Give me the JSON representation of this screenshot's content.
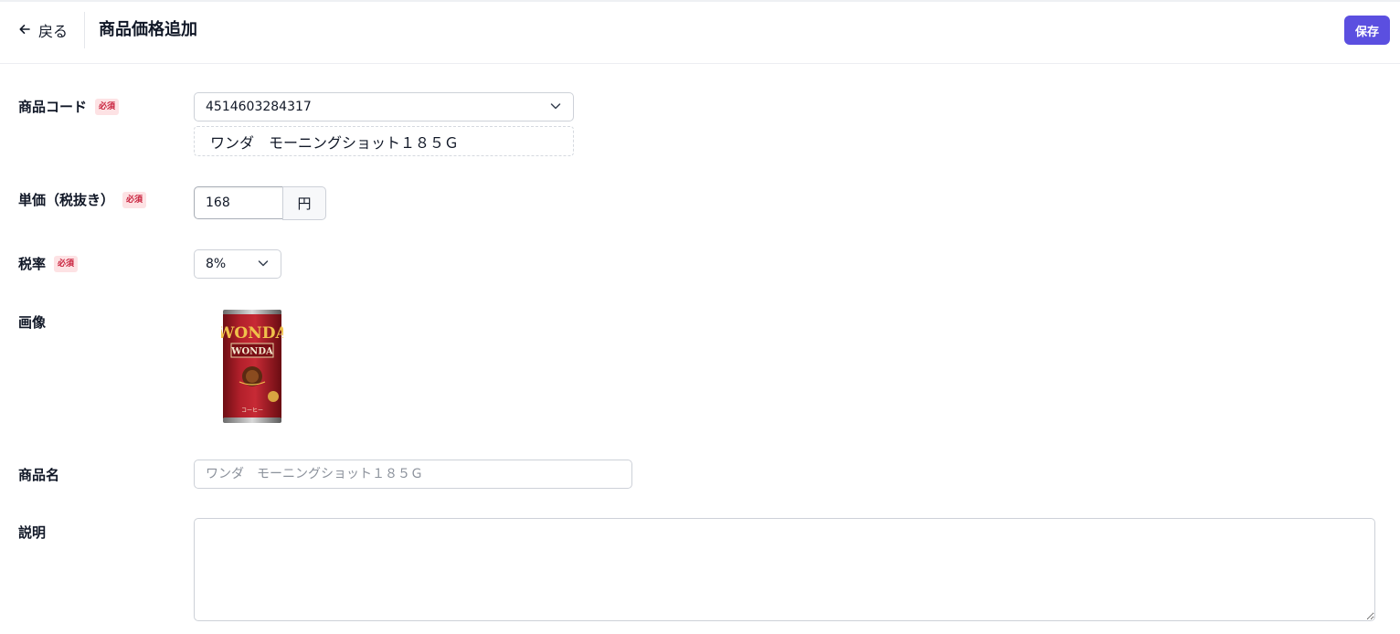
{
  "header": {
    "back_label": "戻る",
    "title": "商品価格追加",
    "save_label": "保存"
  },
  "form": {
    "required_badge": "必須",
    "product_code": {
      "label": "商品コード",
      "value": "4514603284317",
      "resolved_name": "ワンダ　モーニングショット１８５Ｇ"
    },
    "unit_price": {
      "label": "単価（税抜き）",
      "value": "168",
      "unit": "円"
    },
    "tax_rate": {
      "label": "税率",
      "value": "8%"
    },
    "image": {
      "label": "画像",
      "can_brand": "WONDA",
      "can_text": "コーヒー"
    },
    "product_name": {
      "label": "商品名",
      "placeholder": "ワンダ　モーニングショット１８５Ｇ"
    },
    "description": {
      "label": "説明",
      "value": ""
    }
  },
  "colors": {
    "accent": "#5b4fe0",
    "badge_bg": "#fde2e4",
    "badge_text": "#c81e3a"
  }
}
